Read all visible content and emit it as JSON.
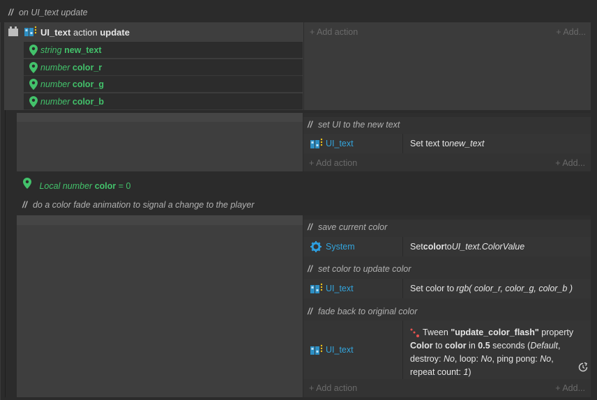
{
  "function": {
    "comment": "on UI_text update",
    "object": "UI_text",
    "kind": "action",
    "name": "update",
    "params": [
      {
        "type": "string",
        "name": "new_text"
      },
      {
        "type": "number",
        "name": "color_r"
      },
      {
        "type": "number",
        "name": "color_g"
      },
      {
        "type": "number",
        "name": "color_b"
      }
    ],
    "add_action": "Add action",
    "add_more": "Add..."
  },
  "event1": {
    "comment": "set UI to the new text",
    "object": "UI_text",
    "desc_prefix": "Set text to ",
    "desc_value": "new_text",
    "add_action": "Add action",
    "add_more": "Add..."
  },
  "local_var": {
    "label_type": "Local number",
    "name": "color",
    "equals": " = 0"
  },
  "group_comment": "do a color fade animation to signal a change to the player",
  "event2": {
    "a1_comment": "save current color",
    "a1_object": "System",
    "a1_set": "Set ",
    "a1_var": "color",
    "a1_to": " to ",
    "a1_expr": "UI_text.ColorValue",
    "a2_comment": "set color to update color",
    "a2_object": "UI_text",
    "a2_set": "Set color to ",
    "a2_expr": "rgb( color_r, color_g, color_b )",
    "a3_comment": "fade back to original color",
    "a3_object": "UI_text",
    "a3_tween": "Tween ",
    "a3_tag": "\"update_color_flash\"",
    "a3_property": " property",
    "a3_prop_name": "Color",
    "a3_to": " to ",
    "a3_var": "color",
    "a3_in": " in ",
    "a3_time": "0.5",
    "a3_seconds": " seconds (",
    "a3_default": "Default",
    "a3_comma1": ",",
    "a3_destroy": "destroy: ",
    "a3_destroy_v": "No",
    "a3_loop": ", loop: ",
    "a3_loop_v": "No",
    "a3_pingpong": ", ping pong: ",
    "a3_pingpong_v": "No",
    "a3_comma2": ",",
    "a3_repeat": "repeat count: ",
    "a3_repeat_v": "1",
    "a3_close": ")",
    "add_action": "Add action",
    "add_more": "Add..."
  },
  "colors": {
    "param_green": "#43c26b",
    "object_blue": "#33a4dc",
    "tween_red": "#e8524f"
  },
  "icons": [
    "sprite-font-icon",
    "location-pin-icon",
    "gear-icon",
    "tween-icon",
    "refresh-icon",
    "plugin-icon"
  ]
}
